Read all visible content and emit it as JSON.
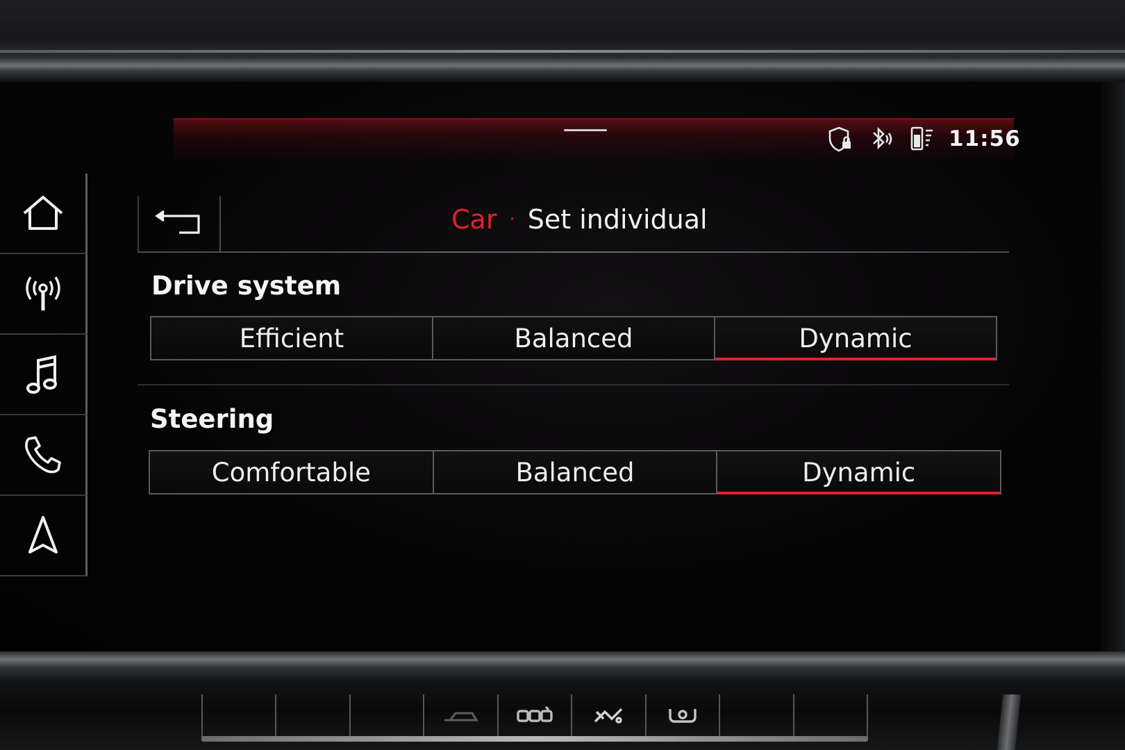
{
  "status": {
    "time": "11:56",
    "icons": [
      "privacy-shield-lock-icon",
      "bluetooth-audio-icon",
      "phone-battery-signal-icon"
    ]
  },
  "sidebar": {
    "items": [
      {
        "name": "home",
        "icon": "home-icon"
      },
      {
        "name": "radio",
        "icon": "radio-antenna-icon"
      },
      {
        "name": "media",
        "icon": "music-note-icon"
      },
      {
        "name": "phone",
        "icon": "phone-icon"
      },
      {
        "name": "navigation",
        "icon": "navigation-arrow-icon"
      }
    ]
  },
  "header": {
    "breadcrumb_parent": "Car",
    "separator": "·",
    "title": "Set individual",
    "back_icon": "back-arrow-icon"
  },
  "sections": [
    {
      "title": "Drive system",
      "options": [
        "Efficient",
        "Balanced",
        "Dynamic"
      ],
      "selected": "Dynamic"
    },
    {
      "title": "Steering",
      "options": [
        "Comfortable",
        "Balanced",
        "Dynamic"
      ],
      "selected": "Dynamic"
    }
  ],
  "colors": {
    "accent": "#e5202b",
    "text": "#f2f2f2",
    "background": "#060506"
  }
}
